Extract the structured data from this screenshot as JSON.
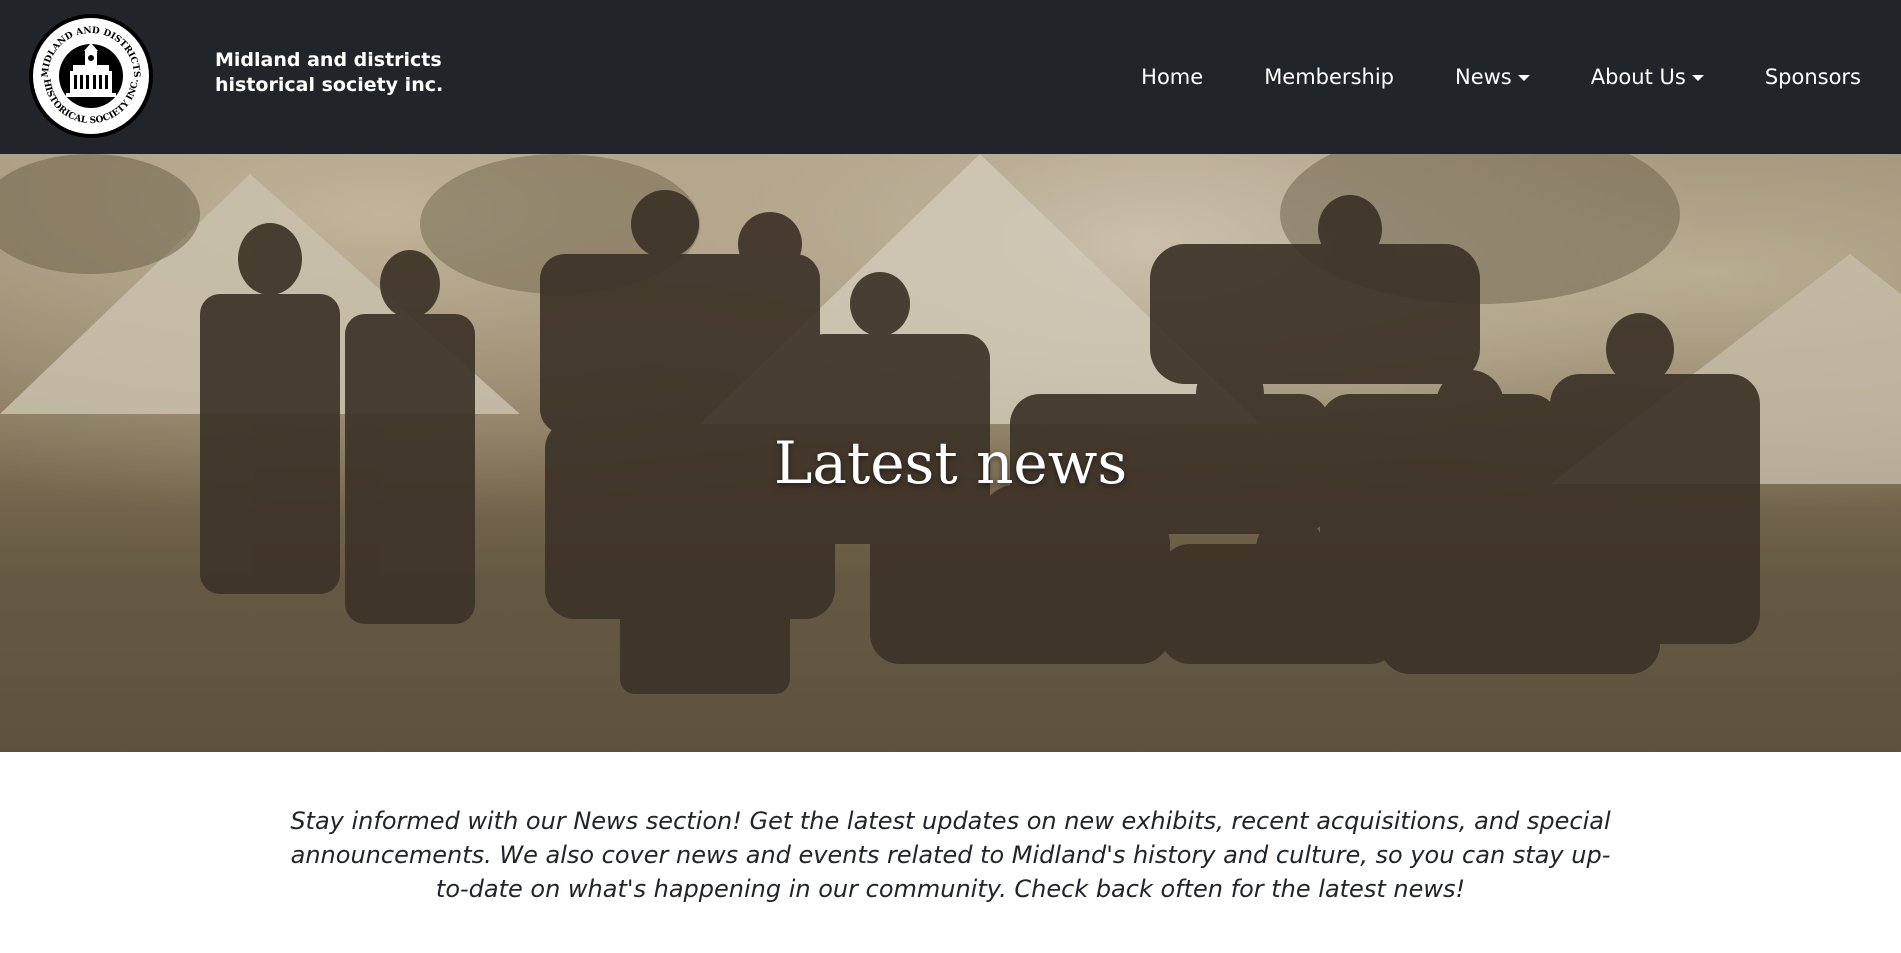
{
  "header": {
    "brand_line1": "Midland and districts",
    "brand_line2": "historical society inc.",
    "logo_top_text": "MIDLAND AND DISTRICTS",
    "logo_bottom_text": "HISTORICAL SOCIETY INC.",
    "nav": [
      {
        "label": "Home",
        "dropdown": false
      },
      {
        "label": "Membership",
        "dropdown": false
      },
      {
        "label": "News",
        "dropdown": true
      },
      {
        "label": "About Us",
        "dropdown": true
      },
      {
        "label": "Sponsors",
        "dropdown": false
      }
    ]
  },
  "hero": {
    "title": "Latest news",
    "image_icon": "historic-soldiers-photo"
  },
  "intro": {
    "text": "Stay informed with our News section! Get the latest updates on new exhibits, recent acquisitions, and special announcements. We also cover news and events related to Midland's history and culture, so you can stay up-to-date on what's happening in our community. Check back often for the latest news!"
  },
  "colors": {
    "navbar_bg": "#212529",
    "nav_text": "#ffffff",
    "body_text": "#212529"
  }
}
